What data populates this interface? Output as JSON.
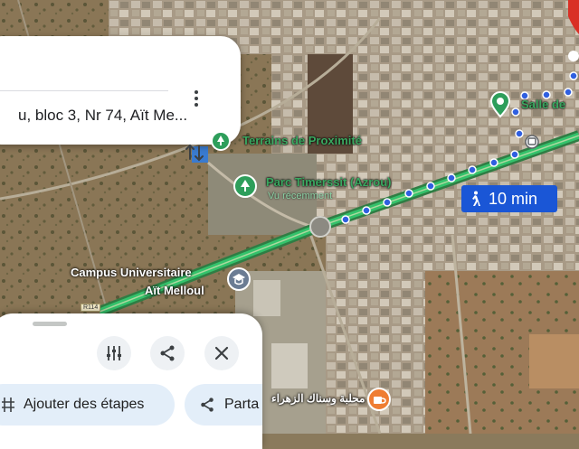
{
  "route_card": {
    "destination_text": "u, bloc 3, Nr 74, Aït Me..."
  },
  "walk_badge": {
    "duration": "10 min"
  },
  "places": {
    "terrains": "Terrains de Proximité",
    "parc": "Parc Timerssit (Azrou)",
    "parc_sub": "Vu récemment",
    "campus_line1": "Campus Universitaire",
    "campus_line2": "Aït Melloul",
    "salle": "Salle de",
    "mahal": "محلبة وسناك الزهراء"
  },
  "road": {
    "tag": "R114"
  },
  "bottom_sheet": {
    "add_stops_label": "Ajouter des étapes",
    "share_label": "Parta"
  },
  "colors": {
    "route_green": "#34c26b",
    "walk_dots": "#2f5fe0",
    "badge_blue": "#1a56d6",
    "chip_bg": "#e3eef9"
  }
}
